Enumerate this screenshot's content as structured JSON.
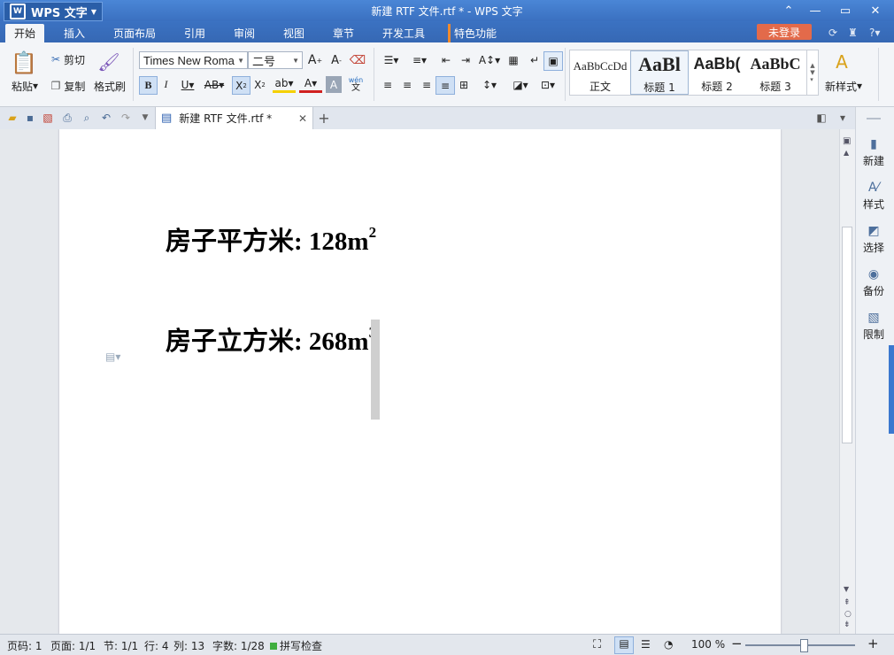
{
  "app": {
    "name": "WPS 文字",
    "window_title": "新建 RTF 文件.rtf * - WPS 文字"
  },
  "menu": {
    "tabs": [
      "开始",
      "插入",
      "页面布局",
      "引用",
      "审阅",
      "视图",
      "章节",
      "开发工具",
      "特色功能"
    ],
    "login_label": "未登录"
  },
  "ribbon": {
    "paste": "粘贴",
    "cut": "剪切",
    "copy": "复制",
    "format_painter": "格式刷",
    "font_name": "Times New Roma",
    "font_size": "二号",
    "wen": "wén",
    "wen_char": "文",
    "styles": [
      {
        "preview": "AaBbCcDd",
        "name": "正文"
      },
      {
        "preview": "AaBl",
        "name": "标题 1"
      },
      {
        "preview": "AaBb(",
        "name": "标题 2"
      },
      {
        "preview": "AaBbC",
        "name": "标题 3"
      }
    ],
    "new_style": "新样式"
  },
  "document": {
    "tab_title": "新建 RTF 文件.rtf *",
    "lines": [
      {
        "text": "房子平方米: 128m",
        "sup": "2"
      },
      {
        "text": "房子立方米: 268m",
        "sup": "3"
      }
    ]
  },
  "side_panel": [
    "新建",
    "样式",
    "选择",
    "备份",
    "限制"
  ],
  "status": {
    "page_no": "页码: 1",
    "pages": "页面: 1/1",
    "section": "节: 1/1",
    "row": "行: 4",
    "col": "列: 13",
    "words": "字数: 1/28",
    "spell": "拼写检查",
    "zoom": "100 %"
  },
  "colors": {
    "title_blue": "#3c76c6",
    "login": "#e36a4a",
    "highlight": "#f5d000",
    "font_color": "#d02020"
  }
}
